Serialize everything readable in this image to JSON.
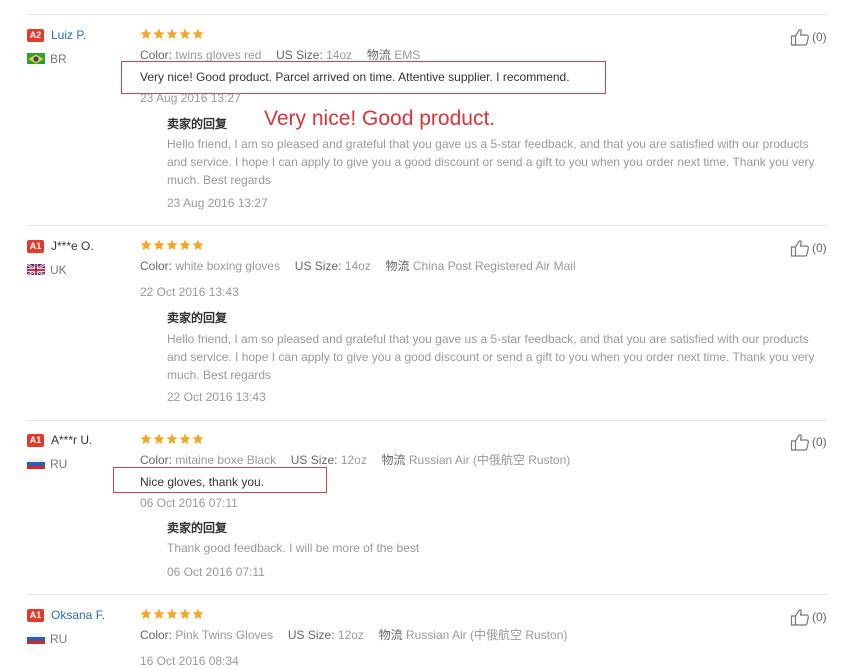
{
  "reviews": [
    {
      "badge": "A2",
      "name": "Luiz P.",
      "name_is_link": true,
      "flag": "br-flag",
      "country": "BR",
      "rating": 5,
      "color_label": "Color:",
      "color_value": "twins gloves red",
      "size_label": "US Size:",
      "size_value": "14oz",
      "logistics_label": "物流",
      "logistics_value": "EMS",
      "comment": "Very nice! Good product. Parcel arrived on time. Attentive supplier. I recommend.",
      "date": "23 Aug 2016 13:27",
      "reply_title": "卖家的回复",
      "reply_text": "Hello friend, I am so pleased and grateful that you gave us a 5-star feedback, and that you are satisfied with our products and service. I hope I can apply to give you a good discount or send a gift to you when you order next time. Thank you very much. Best regards",
      "reply_date": "23 Aug 2016 13:27",
      "likes": "(0)"
    },
    {
      "badge": "A1",
      "name": "J***e O.",
      "name_is_link": false,
      "flag": "uk-flag",
      "country": "UK",
      "rating": 5,
      "color_label": "Color:",
      "color_value": "white boxing gloves",
      "size_label": "US Size:",
      "size_value": "14oz",
      "logistics_label": "物流",
      "logistics_value": "China Post Registered Air Mail",
      "comment": "",
      "date": "22 Oct 2016 13:43",
      "reply_title": "卖家的回复",
      "reply_text": "Hello friend, I am so pleased and grateful that you gave us a 5-star feedback, and that you are satisfied with our products and service. I hope I can apply to give you a good discount or send a gift to you when you order next time. Thank you very much. Best regards",
      "reply_date": "22 Oct 2016 13:43",
      "likes": "(0)"
    },
    {
      "badge": "A1",
      "name": "A***r U.",
      "name_is_link": false,
      "flag": "ru-flag",
      "country": "RU",
      "rating": 5,
      "color_label": "Color:",
      "color_value": "mitaine boxe Black",
      "size_label": "US Size:",
      "size_value": "12oz",
      "logistics_label": "物流",
      "logistics_value": "Russian Air (中俄航空 Ruston)",
      "comment": "Nice gloves, thank you.",
      "date": "06 Oct 2016 07:11",
      "reply_title": "卖家的回复",
      "reply_text": "Thank good feedback. I will be more of the best",
      "reply_date": "06 Oct 2016 07:11",
      "likes": "(0)"
    },
    {
      "badge": "A1",
      "name": "Oksana F.",
      "name_is_link": true,
      "flag": "ru-flag",
      "country": "RU",
      "rating": 5,
      "color_label": "Color:",
      "color_value": "Pink Twins Gloves",
      "size_label": "US Size:",
      "size_value": "12oz",
      "logistics_label": "物流",
      "logistics_value": "Russian Air (中俄航空 Ruston)",
      "comment": "",
      "date": "16 Oct 2016 08:34",
      "likes": "(0)"
    }
  ],
  "overlay_text": "Very nice! Good product.",
  "colors": {
    "badge": "#e43a2b",
    "star": "#f5a623",
    "link": "#2a6cb5",
    "annotation_red": "#d0454d"
  },
  "icons": {
    "like": "thumbs-up-icon",
    "star": "star-icon"
  }
}
